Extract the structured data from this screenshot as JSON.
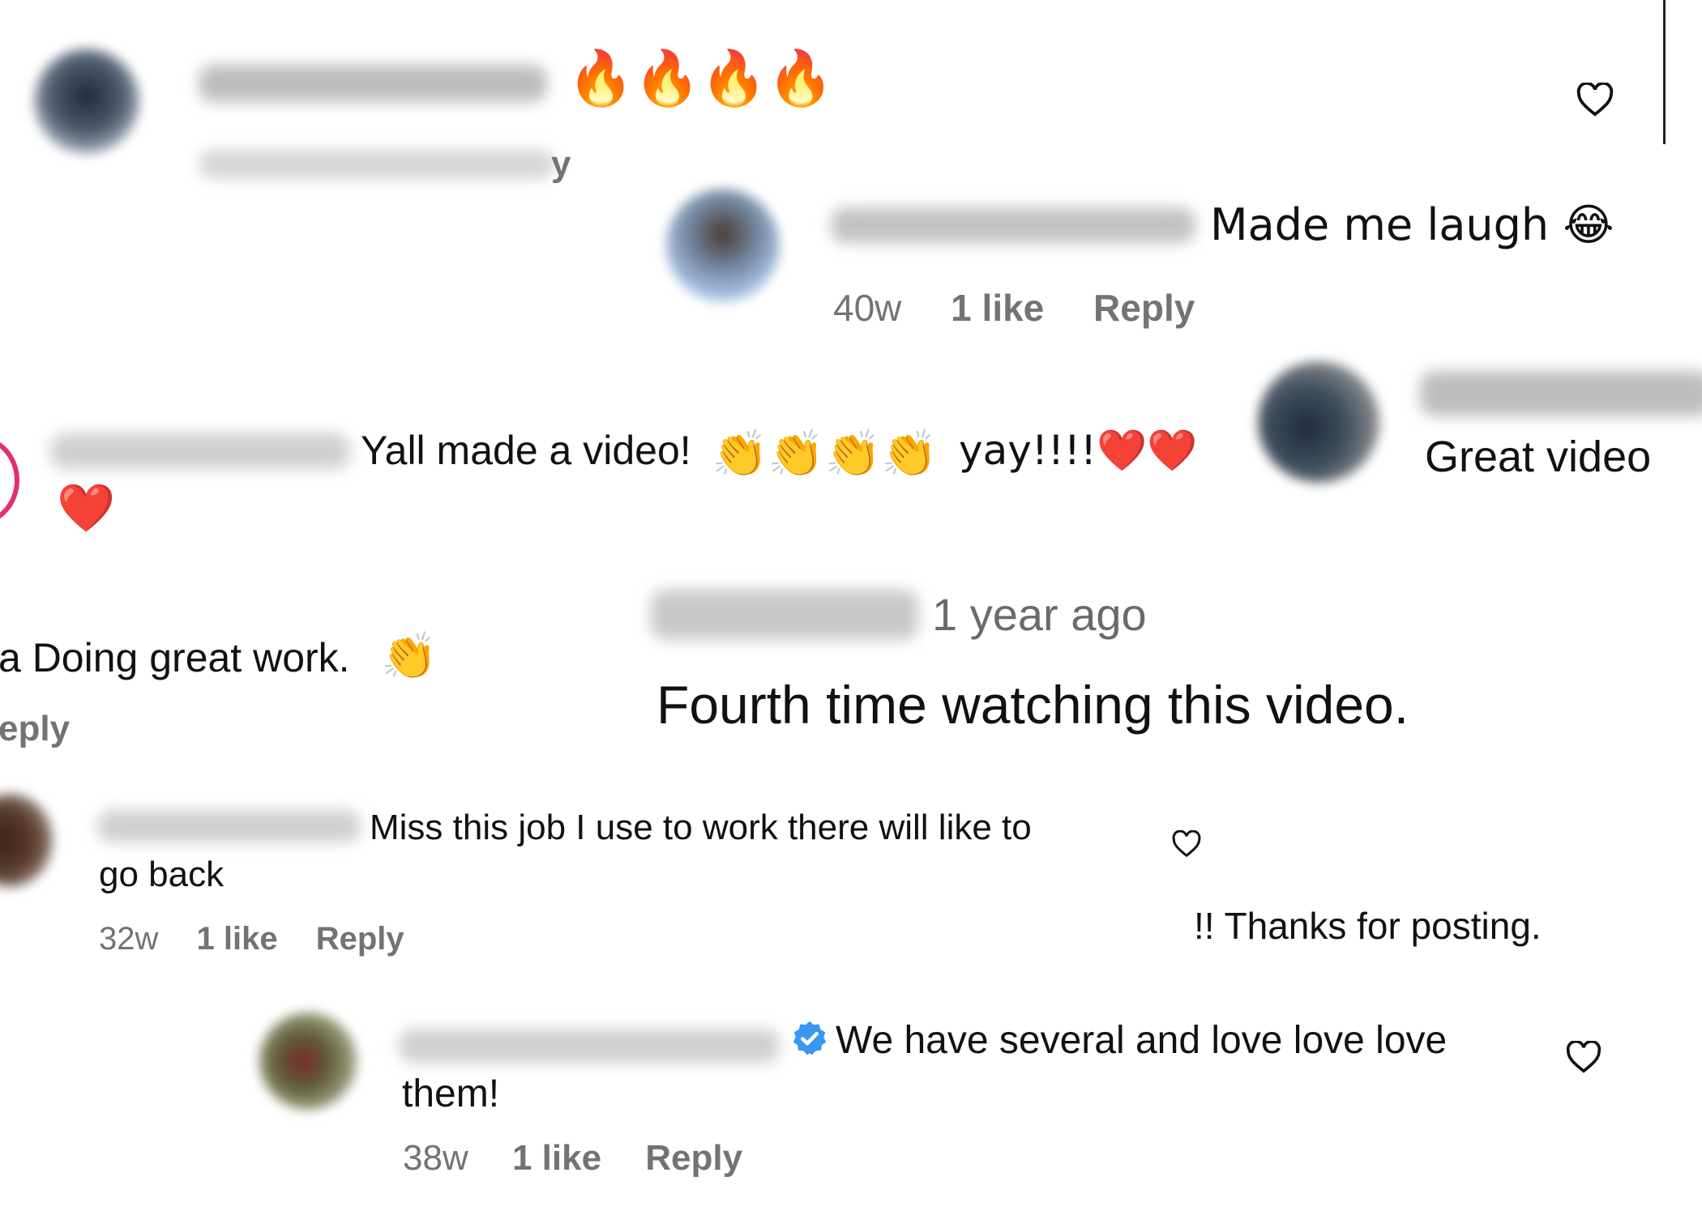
{
  "comments": [
    {
      "text": "🔥🔥🔥🔥",
      "meta": {
        "reply": "y"
      }
    },
    {
      "text": "Made me laugh 😂",
      "meta": {
        "time": "40w",
        "likes": "1 like",
        "reply": "Reply"
      }
    },
    {
      "text_before": "Yall made a video!",
      "claps": "👏👏👏👏",
      "text_after": "yay!!!!❤️❤️",
      "text_line2": "❤️"
    },
    {
      "text": "Great video"
    },
    {
      "text": "a Doing great work.",
      "emoji": "👏",
      "meta": {
        "reply": "eply"
      }
    },
    {
      "time_label": "1 year ago",
      "text": "Fourth time watching this video."
    },
    {
      "text_line1": "Miss this job I use to work there will like to",
      "text_line2": "go back",
      "meta": {
        "time": "32w",
        "likes": "1 like",
        "reply": "Reply"
      }
    },
    {
      "text": "!! Thanks for posting."
    },
    {
      "text_line1": "We have several and love love love",
      "text_line2": "them!",
      "meta": {
        "time": "38w",
        "likes": "1 like",
        "reply": "Reply"
      }
    }
  ],
  "colors": {
    "text": "#111111",
    "meta": "#737373",
    "verified": "#3897f0",
    "story_ring": "#e1306c"
  }
}
